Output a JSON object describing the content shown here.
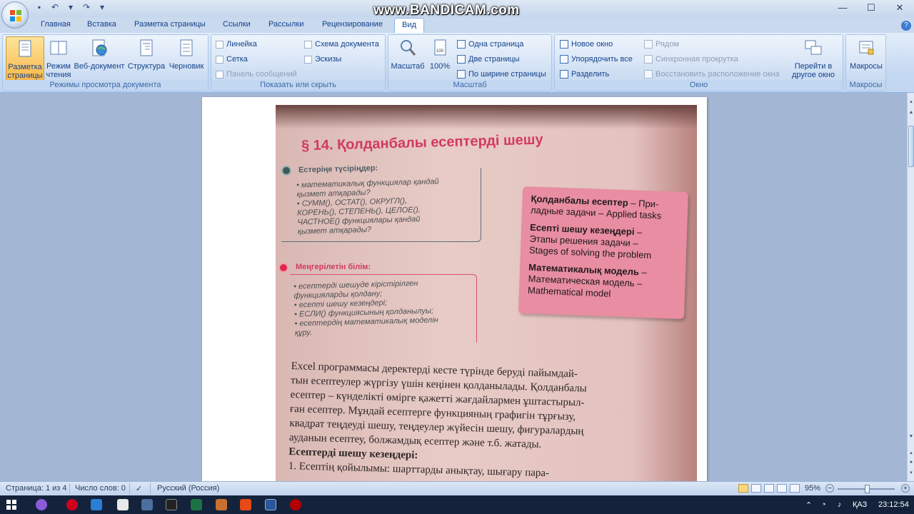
{
  "title_bar": {
    "watermark": "www.BANDICAM.com",
    "controls": [
      "—",
      "☐",
      "✕"
    ]
  },
  "tabs": [
    "Главная",
    "Вставка",
    "Разметка страницы",
    "Ссылки",
    "Рассылки",
    "Рецензирование",
    "Вид"
  ],
  "active_tab": "Вид",
  "ribbon": {
    "views_group": {
      "label": "Режимы просмотра документа",
      "buttons": [
        {
          "label1": "Разметка",
          "label2": "страницы"
        },
        {
          "label1": "Режим",
          "label2": "чтения"
        },
        {
          "label1": "Веб-документ",
          "label2": ""
        },
        {
          "label1": "Структура",
          "label2": ""
        },
        {
          "label1": "Черновик",
          "label2": ""
        }
      ]
    },
    "show_group": {
      "label": "Показать или скрыть",
      "items": [
        "Линейка",
        "Сетка",
        "Панель сообщений",
        "Схема документа",
        "Эскизы"
      ]
    },
    "zoom_group": {
      "label": "Масштаб",
      "zoom_button": "Масштаб",
      "percent_button": "100%",
      "items": [
        "Одна страница",
        "Две страницы",
        "По ширине страницы"
      ]
    },
    "window_group": {
      "label": "Окно",
      "items": [
        "Новое окно",
        "Упорядочить все",
        "Разделить"
      ],
      "disabled_items": [
        "Рядом",
        "Синхронная прокрутка",
        "Восстановить расположение окна"
      ],
      "switch_label1": "Перейти в",
      "switch_label2": "другое окно"
    },
    "macros_group": {
      "label": "Макросы",
      "button": "Макросы"
    }
  },
  "document": {
    "heading": "§ 14. Қолданбалы есептерді шешу",
    "recall_title": "Естеріңе түсіріңдер:",
    "recall_items": [
      "• математикалық функциялар қандай",
      "  қызмет атқарады?",
      "• СУММ(), ОСТАТ(), ОКРУГЛ(),",
      "  КОРЕНЬ(), СТЕПЕНЬ(), ЦЕЛОЕ(),",
      "  ЧАСТНОЕ() функциялары қандай",
      "  қызмет атқарады?"
    ],
    "learn_title": "Меңгерілетін білім:",
    "learn_items": [
      "• есептерді шешуде кірістірілген",
      "  функцияларды қолдану;",
      "• есепті шешу кезеңдері;",
      "• ЕСЛИ() функциясының қолданылуы;",
      "• есептердің математикалық моделін",
      "  құру."
    ],
    "glossary": [
      {
        "term": "Қолданбалы есептер",
        "rest": " – При-"
      },
      {
        "term": "",
        "rest": "ладные задачи – Applied tasks"
      },
      {
        "term": "Есепті шешу кезеңдері",
        "rest": " –"
      },
      {
        "term": "",
        "rest": "Этапы решения задачи –"
      },
      {
        "term": "",
        "rest": "Stages of solving the problem"
      },
      {
        "term": "Математикалық модель",
        "rest": " –"
      },
      {
        "term": "",
        "rest": "Математическая модель –"
      },
      {
        "term": "",
        "rest": "Mathematical model"
      }
    ],
    "body_lines": [
      "    Excel программасы деректерді кесте түрінде беруді пайымдай-",
      "тын есептеулер жүргізу үшін кеңінен қолданылады. Қолданбалы",
      "есептер – күнделікті өмірге қажетті жағдайлармен ұштастырыл-",
      "ған есептер. Мұндай есептерге функцияның графигін тұрғызу,",
      "квадрат теңдеуді шешу, теңдеулер жүйесін шешу, фигуралардың",
      "ауданын есептеу, болжамдық есептер және т.б. жатады.",
      "    Есептерді шешу кезеңдері:",
      "1.  Есептің қойылымы: шарттарды анықтау, шығару пара-"
    ]
  },
  "status_bar": {
    "page": "Страница: 1 из 4",
    "words": "Число слов: 0",
    "language": "Русский (Россия)",
    "zoom": "95%"
  },
  "taskbar": {
    "lang": "ҚАЗ",
    "time": "23:12:54"
  }
}
